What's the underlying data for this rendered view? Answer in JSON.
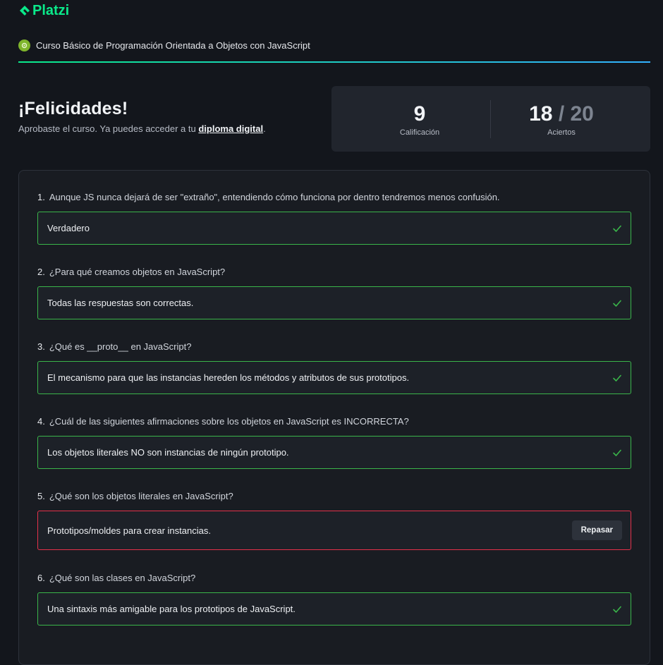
{
  "brand": {
    "name": "Platzi"
  },
  "course": {
    "title": "Curso Básico de Programación Orientada a Objetos con JavaScript"
  },
  "result": {
    "heading": "¡Felicidades!",
    "message_prefix": "Aprobaste el curso. Ya puedes acceder a tu ",
    "diploma_link": "diploma digital",
    "message_suffix": ".",
    "score_value": "9",
    "score_label": "Calificación",
    "correct": "18",
    "separator": " / ",
    "total": "20",
    "correct_label": "Aciertos"
  },
  "questions": [
    {
      "number": "1.",
      "text": "Aunque JS nunca dejará de ser \"extraño\", entendiendo cómo funciona por dentro tendremos menos confusión.",
      "answer": "Verdadero",
      "status": "correct"
    },
    {
      "number": "2.",
      "text": "¿Para qué creamos objetos en JavaScript?",
      "answer": "Todas las respuestas son correctas.",
      "status": "correct"
    },
    {
      "number": "3.",
      "text": "¿Qué es __proto__ en JavaScript?",
      "answer": "El mecanismo para que las instancias hereden los métodos y atributos de sus prototipos.",
      "status": "correct"
    },
    {
      "number": "4.",
      "text": "¿Cuál de las siguientes afirmaciones sobre los objetos en JavaScript es INCORRECTA?",
      "answer": "Los objetos literales NO son instancias de ningún prototipo.",
      "status": "correct"
    },
    {
      "number": "5.",
      "text": "¿Qué son los objetos literales en JavaScript?",
      "answer": "Prototipos/moldes para crear instancias.",
      "status": "incorrect",
      "action_label": "Repasar"
    },
    {
      "number": "6.",
      "text": "¿Qué son las clases en JavaScript?",
      "answer": "Una sintaxis más amigable para los prototipos de JavaScript.",
      "status": "correct"
    }
  ],
  "colors": {
    "brand": "#0ae98a",
    "correct": "#3ab54a",
    "incorrect": "#e5314a",
    "background": "#13161c"
  },
  "icons": {
    "correct": "check-icon",
    "logo": "platzi-logo-icon",
    "course": "course-badge-icon"
  }
}
